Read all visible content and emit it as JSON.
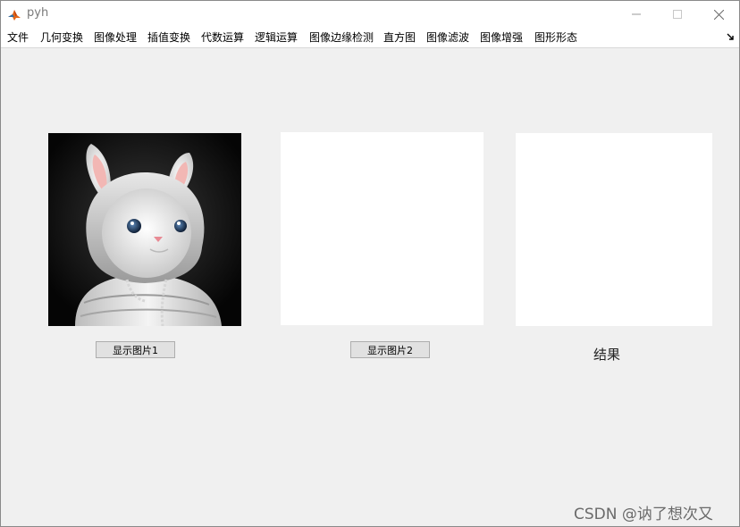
{
  "window": {
    "title": "pyh"
  },
  "menu": {
    "items": [
      "文件",
      "几何变换",
      "图像处理",
      "插值变换",
      "代数运算",
      "逻辑运算",
      "图像边缘检测",
      "直方图",
      "图像滤波",
      "图像增强",
      "图形形态"
    ]
  },
  "panels": {
    "button1_label": "显示图片1",
    "button2_label": "显示图片2",
    "result_label": "结果"
  },
  "image1": {
    "subject": "white rabbit character wearing a white hoodie, dark background"
  },
  "watermark": "CSDN @讷了想次又",
  "colors": {
    "window_bg": "#f0f0f0",
    "titlebar_bg": "#ffffff",
    "axes_bg": "#ffffff",
    "button_bg": "#e1e1e1"
  }
}
